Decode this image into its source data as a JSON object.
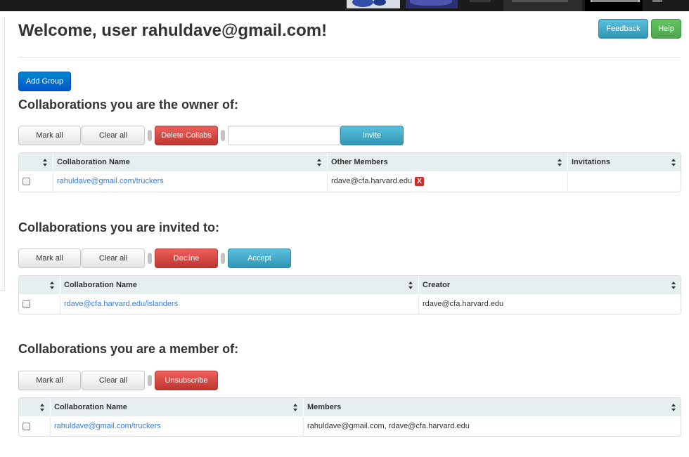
{
  "header": {
    "welcome": "Welcome, user rahuldave@gmail.com!",
    "feedback_label": "Feedback",
    "help_label": "Help"
  },
  "add_group_label": "Add Group",
  "owner_section": {
    "title": "Collaborations you are the owner of:",
    "mark_all": "Mark all",
    "clear_all": "Clear all",
    "delete_label": "Delete Collabs",
    "invite_placeholder": "",
    "invite_label": "Invite",
    "columns": [
      "Collaboration Name",
      "Other Members",
      "Invitations"
    ],
    "rows": [
      {
        "name": "rahuldave@gmail.com/truckers",
        "members": "rdave@cfa.harvard.edu",
        "remove": "X",
        "invitations": ""
      }
    ]
  },
  "invited_section": {
    "title": "Collaborations you are invited to:",
    "mark_all": "Mark all",
    "clear_all": "Clear all",
    "decline_label": "Decline",
    "accept_label": "Accept",
    "columns": [
      "Collaboration Name",
      "Creator"
    ],
    "rows": [
      {
        "name": "rdave@cfa.harvard.edu/islanders",
        "creator": "rdave@cfa.harvard.edu"
      }
    ]
  },
  "member_section": {
    "title": "Collaborations you are a member of:",
    "mark_all": "Mark all",
    "clear_all": "Clear all",
    "unsubscribe_label": "Unsubscribe",
    "columns": [
      "Collaboration Name",
      "Members"
    ],
    "rows": [
      {
        "name": "rahuldave@gmail.com/truckers",
        "members": "rahuldave@gmail.com, rdave@cfa.harvard.edu"
      }
    ]
  }
}
